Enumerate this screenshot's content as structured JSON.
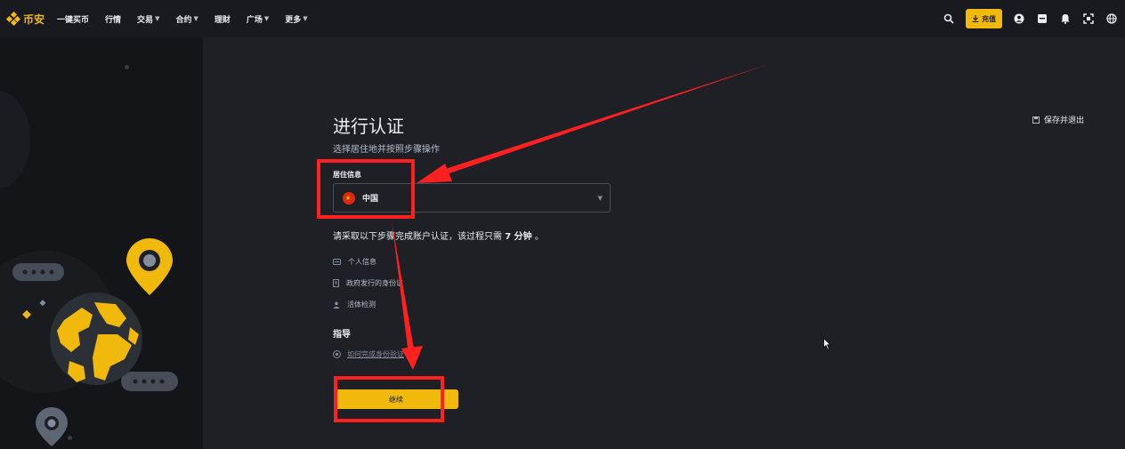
{
  "brand": {
    "name": "币安",
    "color": "#f0b90b"
  },
  "nav": {
    "items": [
      {
        "label": "一键买币",
        "has_caret": false
      },
      {
        "label": "行情",
        "has_caret": false
      },
      {
        "label": "交易",
        "has_caret": true
      },
      {
        "label": "合约",
        "has_caret": true
      },
      {
        "label": "理财",
        "has_caret": false
      },
      {
        "label": "广场",
        "has_caret": true
      },
      {
        "label": "更多",
        "has_caret": true
      }
    ]
  },
  "toolbar": {
    "deposit_label": "充值",
    "icons": [
      "search-icon",
      "deposit-icon",
      "user-icon",
      "orders-icon",
      "bell-icon",
      "download-icon",
      "globe-icon"
    ]
  },
  "page": {
    "title": "进行认证",
    "subtitle": "选择居住地并按照步骤操作",
    "save_exit": "保存并退出",
    "residence_label": "居住信息",
    "residence_value": "中国",
    "note_prefix": "请采取以下步骤完成账户认证，该过程只需",
    "note_time": "7 分钟",
    "note_suffix": "。",
    "steps": [
      {
        "icon": "id-card-icon",
        "label": "个人信息"
      },
      {
        "icon": "document-icon",
        "label": "政府发行的身份证"
      },
      {
        "icon": "person-icon",
        "label": "活体检测"
      }
    ],
    "guide_title": "指导",
    "guide_link": "如何完成身份验证",
    "continue_label": "继续"
  },
  "colors": {
    "accent": "#f0b90b",
    "annotation": "#ff2020",
    "background": "#1e2026"
  }
}
